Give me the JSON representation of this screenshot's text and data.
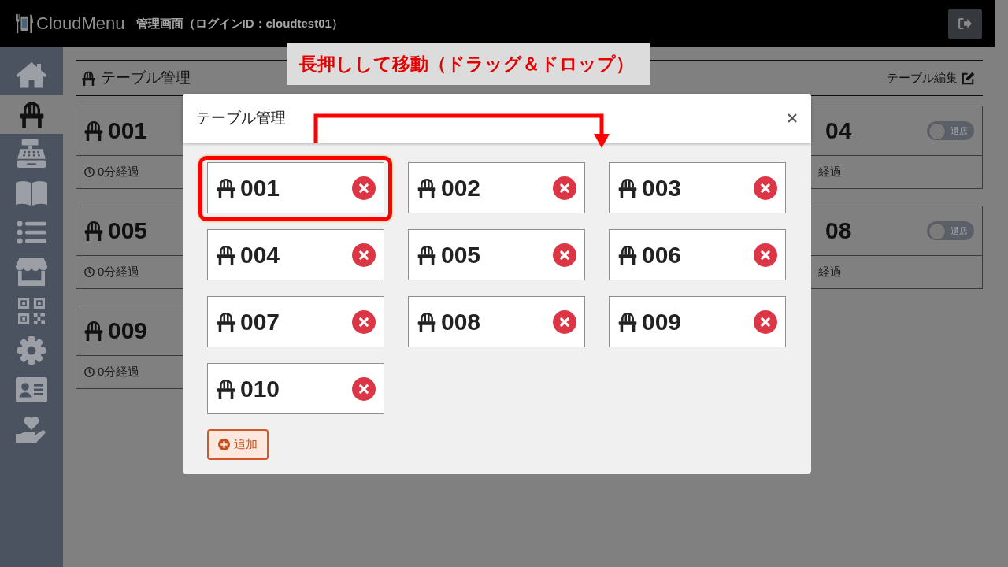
{
  "header": {
    "logo_text": "CloudMenu",
    "title": "管理画面（ログインID：cloudtest01）"
  },
  "sidebar": {
    "items": [
      {
        "selected": false
      },
      {
        "selected": true
      },
      {
        "selected": false
      },
      {
        "selected": false
      },
      {
        "selected": false
      },
      {
        "selected": false
      },
      {
        "selected": false
      },
      {
        "selected": false
      },
      {
        "selected": false
      },
      {
        "selected": false
      }
    ]
  },
  "page": {
    "title": "テーブル管理",
    "edit_link": "テーブル編集",
    "left_cards": [
      {
        "number": "001",
        "elapsed": "0分経過"
      },
      {
        "number": "005",
        "elapsed": "0分経過"
      },
      {
        "number": "009",
        "elapsed": "0分経過"
      }
    ],
    "right_cards": [
      {
        "number": "04",
        "elapsed": "経過",
        "toggle": {
          "label": "退店",
          "on": false
        }
      },
      {
        "number": "08",
        "elapsed": "経過",
        "toggle": {
          "label": "退店",
          "on": false
        }
      }
    ]
  },
  "callout": {
    "text": "長押しして移動（ドラッグ＆ドロップ）"
  },
  "modal": {
    "title": "テーブル管理",
    "tiles": [
      {
        "number": "001",
        "highlighted": true
      },
      {
        "number": "002",
        "highlighted": false
      },
      {
        "number": "003",
        "highlighted": false
      },
      {
        "number": "004",
        "highlighted": false
      },
      {
        "number": "005",
        "highlighted": false
      },
      {
        "number": "006",
        "highlighted": false
      },
      {
        "number": "007",
        "highlighted": false
      },
      {
        "number": "008",
        "highlighted": false
      },
      {
        "number": "009",
        "highlighted": false
      },
      {
        "number": "010",
        "highlighted": false
      }
    ],
    "add_button": "追加"
  }
}
